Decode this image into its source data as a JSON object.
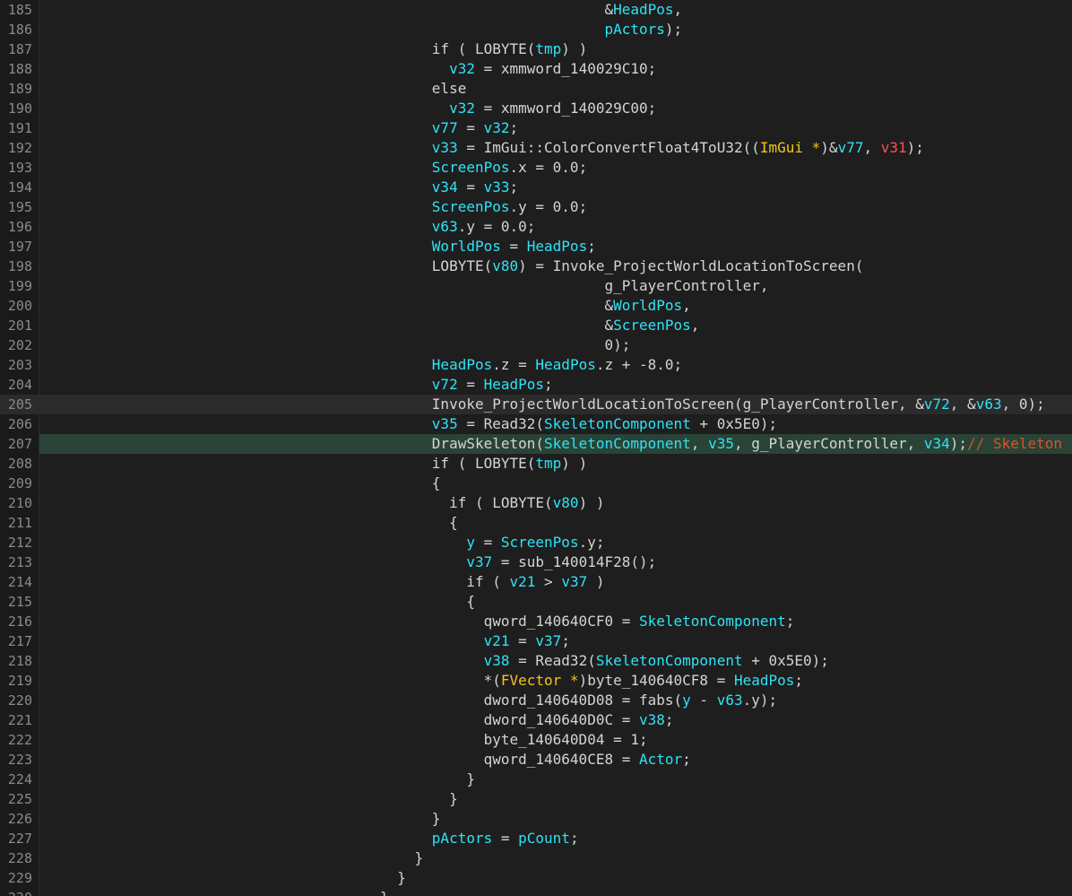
{
  "editor": {
    "colors": {
      "background": "#1e1e1e",
      "gutter": "#1a1a1a",
      "line_number": "#8a8a8a",
      "default_text": "#d4d4d4",
      "variable": "#2ee3f5",
      "type": "#f5c518",
      "argument": "#ff4f4f",
      "comment": "#e0512c",
      "current_line": "#2b2b2b",
      "selected_line": "#294436"
    },
    "current_line_number": "205",
    "selected_line_number": "207",
    "lines": [
      {
        "num": "185",
        "tokens": [
          {
            "t": "                          &",
            "c": "d"
          },
          {
            "t": "HeadPos",
            "c": "v"
          },
          {
            "t": ",",
            "c": "d"
          }
        ]
      },
      {
        "num": "186",
        "tokens": [
          {
            "t": "                          ",
            "c": "d"
          },
          {
            "t": "pActors",
            "c": "v"
          },
          {
            "t": ");",
            "c": "d"
          }
        ]
      },
      {
        "num": "187",
        "tokens": [
          {
            "t": "      if ( LOBYTE(",
            "c": "d"
          },
          {
            "t": "tmp",
            "c": "v"
          },
          {
            "t": ") )",
            "c": "d"
          }
        ]
      },
      {
        "num": "188",
        "tokens": [
          {
            "t": "        ",
            "c": "d"
          },
          {
            "t": "v32",
            "c": "v"
          },
          {
            "t": " = xmmword_140029C10;",
            "c": "d"
          }
        ]
      },
      {
        "num": "189",
        "tokens": [
          {
            "t": "      else",
            "c": "d"
          }
        ]
      },
      {
        "num": "190",
        "tokens": [
          {
            "t": "        ",
            "c": "d"
          },
          {
            "t": "v32",
            "c": "v"
          },
          {
            "t": " = xmmword_140029C00;",
            "c": "d"
          }
        ]
      },
      {
        "num": "191",
        "tokens": [
          {
            "t": "      ",
            "c": "d"
          },
          {
            "t": "v77",
            "c": "v"
          },
          {
            "t": " = ",
            "c": "d"
          },
          {
            "t": "v32",
            "c": "v"
          },
          {
            "t": ";",
            "c": "d"
          }
        ]
      },
      {
        "num": "192",
        "tokens": [
          {
            "t": "      ",
            "c": "d"
          },
          {
            "t": "v33",
            "c": "v"
          },
          {
            "t": " = ImGui::ColorConvertFloat4ToU32((",
            "c": "d"
          },
          {
            "t": "ImGui *",
            "c": "y"
          },
          {
            "t": ")&",
            "c": "d"
          },
          {
            "t": "v77",
            "c": "v"
          },
          {
            "t": ", ",
            "c": "d"
          },
          {
            "t": "v31",
            "c": "r"
          },
          {
            "t": ");",
            "c": "d"
          }
        ]
      },
      {
        "num": "193",
        "tokens": [
          {
            "t": "      ",
            "c": "d"
          },
          {
            "t": "ScreenPos",
            "c": "v"
          },
          {
            "t": ".x = 0.0;",
            "c": "d"
          }
        ]
      },
      {
        "num": "194",
        "tokens": [
          {
            "t": "      ",
            "c": "d"
          },
          {
            "t": "v34",
            "c": "v"
          },
          {
            "t": " = ",
            "c": "d"
          },
          {
            "t": "v33",
            "c": "v"
          },
          {
            "t": ";",
            "c": "d"
          }
        ]
      },
      {
        "num": "195",
        "tokens": [
          {
            "t": "      ",
            "c": "d"
          },
          {
            "t": "ScreenPos",
            "c": "v"
          },
          {
            "t": ".y = 0.0;",
            "c": "d"
          }
        ]
      },
      {
        "num": "196",
        "tokens": [
          {
            "t": "      ",
            "c": "d"
          },
          {
            "t": "v63",
            "c": "v"
          },
          {
            "t": ".y = 0.0;",
            "c": "d"
          }
        ]
      },
      {
        "num": "197",
        "tokens": [
          {
            "t": "      ",
            "c": "d"
          },
          {
            "t": "WorldPos",
            "c": "v"
          },
          {
            "t": " = ",
            "c": "d"
          },
          {
            "t": "HeadPos",
            "c": "v"
          },
          {
            "t": ";",
            "c": "d"
          }
        ]
      },
      {
        "num": "198",
        "tokens": [
          {
            "t": "      LOBYTE(",
            "c": "d"
          },
          {
            "t": "v80",
            "c": "v"
          },
          {
            "t": ") = Invoke_ProjectWorldLocationToScreen(",
            "c": "d"
          }
        ]
      },
      {
        "num": "199",
        "tokens": [
          {
            "t": "                          g_PlayerController,",
            "c": "d"
          }
        ]
      },
      {
        "num": "200",
        "tokens": [
          {
            "t": "                          &",
            "c": "d"
          },
          {
            "t": "WorldPos",
            "c": "v"
          },
          {
            "t": ",",
            "c": "d"
          }
        ]
      },
      {
        "num": "201",
        "tokens": [
          {
            "t": "                          &",
            "c": "d"
          },
          {
            "t": "ScreenPos",
            "c": "v"
          },
          {
            "t": ",",
            "c": "d"
          }
        ]
      },
      {
        "num": "202",
        "tokens": [
          {
            "t": "                          0);",
            "c": "d"
          }
        ]
      },
      {
        "num": "203",
        "tokens": [
          {
            "t": "      ",
            "c": "d"
          },
          {
            "t": "HeadPos",
            "c": "v"
          },
          {
            "t": ".z = ",
            "c": "d"
          },
          {
            "t": "HeadPos",
            "c": "v"
          },
          {
            "t": ".z + -8.0;",
            "c": "d"
          }
        ]
      },
      {
        "num": "204",
        "tokens": [
          {
            "t": "      ",
            "c": "d"
          },
          {
            "t": "v72",
            "c": "v"
          },
          {
            "t": " = ",
            "c": "d"
          },
          {
            "t": "HeadPos",
            "c": "v"
          },
          {
            "t": ";",
            "c": "d"
          }
        ]
      },
      {
        "num": "205",
        "tokens": [
          {
            "t": "      Invoke_ProjectWorldLocationToScreen(g_PlayerController, &",
            "c": "d"
          },
          {
            "t": "v72",
            "c": "v"
          },
          {
            "t": ", &",
            "c": "d"
          },
          {
            "t": "v63",
            "c": "v"
          },
          {
            "t": ", 0);",
            "c": "d"
          }
        ]
      },
      {
        "num": "206",
        "tokens": [
          {
            "t": "      ",
            "c": "d"
          },
          {
            "t": "v35",
            "c": "v"
          },
          {
            "t": " = Read32(",
            "c": "d"
          },
          {
            "t": "SkeletonComponent",
            "c": "v"
          },
          {
            "t": " + 0x5E0);",
            "c": "d"
          }
        ]
      },
      {
        "num": "207",
        "tokens": [
          {
            "t": "      DrawSkeleton(",
            "c": "d"
          },
          {
            "t": "SkeletonComponent",
            "c": "v"
          },
          {
            "t": ", ",
            "c": "d"
          },
          {
            "t": "v35",
            "c": "v"
          },
          {
            "t": ", g_PlayerController, ",
            "c": "d"
          },
          {
            "t": "v34",
            "c": "v"
          },
          {
            "t": ");",
            "c": "d"
          },
          {
            "t": "// Skeleton",
            "c": "c"
          }
        ]
      },
      {
        "num": "208",
        "tokens": [
          {
            "t": "      if ( LOBYTE(",
            "c": "d"
          },
          {
            "t": "tmp",
            "c": "v"
          },
          {
            "t": ") )",
            "c": "d"
          }
        ]
      },
      {
        "num": "209",
        "tokens": [
          {
            "t": "      {",
            "c": "d"
          }
        ]
      },
      {
        "num": "210",
        "tokens": [
          {
            "t": "        if ( LOBYTE(",
            "c": "d"
          },
          {
            "t": "v80",
            "c": "v"
          },
          {
            "t": ") )",
            "c": "d"
          }
        ]
      },
      {
        "num": "211",
        "tokens": [
          {
            "t": "        {",
            "c": "d"
          }
        ]
      },
      {
        "num": "212",
        "tokens": [
          {
            "t": "          ",
            "c": "d"
          },
          {
            "t": "y",
            "c": "v"
          },
          {
            "t": " = ",
            "c": "d"
          },
          {
            "t": "ScreenPos",
            "c": "v"
          },
          {
            "t": ".y;",
            "c": "d"
          }
        ]
      },
      {
        "num": "213",
        "tokens": [
          {
            "t": "          ",
            "c": "d"
          },
          {
            "t": "v37",
            "c": "v"
          },
          {
            "t": " = sub_140014F28();",
            "c": "d"
          }
        ]
      },
      {
        "num": "214",
        "tokens": [
          {
            "t": "          if ( ",
            "c": "d"
          },
          {
            "t": "v21",
            "c": "v"
          },
          {
            "t": " > ",
            "c": "d"
          },
          {
            "t": "v37",
            "c": "v"
          },
          {
            "t": " )",
            "c": "d"
          }
        ]
      },
      {
        "num": "215",
        "tokens": [
          {
            "t": "          {",
            "c": "d"
          }
        ]
      },
      {
        "num": "216",
        "tokens": [
          {
            "t": "            qword_140640CF0 = ",
            "c": "d"
          },
          {
            "t": "SkeletonComponent",
            "c": "v"
          },
          {
            "t": ";",
            "c": "d"
          }
        ]
      },
      {
        "num": "217",
        "tokens": [
          {
            "t": "            ",
            "c": "d"
          },
          {
            "t": "v21",
            "c": "v"
          },
          {
            "t": " = ",
            "c": "d"
          },
          {
            "t": "v37",
            "c": "v"
          },
          {
            "t": ";",
            "c": "d"
          }
        ]
      },
      {
        "num": "218",
        "tokens": [
          {
            "t": "            ",
            "c": "d"
          },
          {
            "t": "v38",
            "c": "v"
          },
          {
            "t": " = Read32(",
            "c": "d"
          },
          {
            "t": "SkeletonComponent",
            "c": "v"
          },
          {
            "t": " + 0x5E0);",
            "c": "d"
          }
        ]
      },
      {
        "num": "219",
        "tokens": [
          {
            "t": "            *(",
            "c": "d"
          },
          {
            "t": "FVector *",
            "c": "y"
          },
          {
            "t": ")byte_140640CF8 = ",
            "c": "d"
          },
          {
            "t": "HeadPos",
            "c": "v"
          },
          {
            "t": ";",
            "c": "d"
          }
        ]
      },
      {
        "num": "220",
        "tokens": [
          {
            "t": "            dword_140640D08 = fabs(",
            "c": "d"
          },
          {
            "t": "y",
            "c": "v"
          },
          {
            "t": " - ",
            "c": "d"
          },
          {
            "t": "v63",
            "c": "v"
          },
          {
            "t": ".y);",
            "c": "d"
          }
        ]
      },
      {
        "num": "221",
        "tokens": [
          {
            "t": "            dword_140640D0C = ",
            "c": "d"
          },
          {
            "t": "v38",
            "c": "v"
          },
          {
            "t": ";",
            "c": "d"
          }
        ]
      },
      {
        "num": "222",
        "tokens": [
          {
            "t": "            byte_140640D04 = 1;",
            "c": "d"
          }
        ]
      },
      {
        "num": "223",
        "tokens": [
          {
            "t": "            qword_140640CE8 = ",
            "c": "d"
          },
          {
            "t": "Actor",
            "c": "v"
          },
          {
            "t": ";",
            "c": "d"
          }
        ]
      },
      {
        "num": "224",
        "tokens": [
          {
            "t": "          }",
            "c": "d"
          }
        ]
      },
      {
        "num": "225",
        "tokens": [
          {
            "t": "        }",
            "c": "d"
          }
        ]
      },
      {
        "num": "226",
        "tokens": [
          {
            "t": "      }",
            "c": "d"
          }
        ]
      },
      {
        "num": "227",
        "tokens": [
          {
            "t": "      ",
            "c": "d"
          },
          {
            "t": "pActors",
            "c": "v"
          },
          {
            "t": " = ",
            "c": "d"
          },
          {
            "t": "pCount",
            "c": "v"
          },
          {
            "t": ";",
            "c": "d"
          }
        ]
      },
      {
        "num": "228",
        "tokens": [
          {
            "t": "    }",
            "c": "d"
          }
        ]
      },
      {
        "num": "229",
        "tokens": [
          {
            "t": "  }",
            "c": "d"
          }
        ]
      },
      {
        "num": "230",
        "tokens": [
          {
            "t": "}",
            "c": "d"
          }
        ]
      }
    ]
  }
}
